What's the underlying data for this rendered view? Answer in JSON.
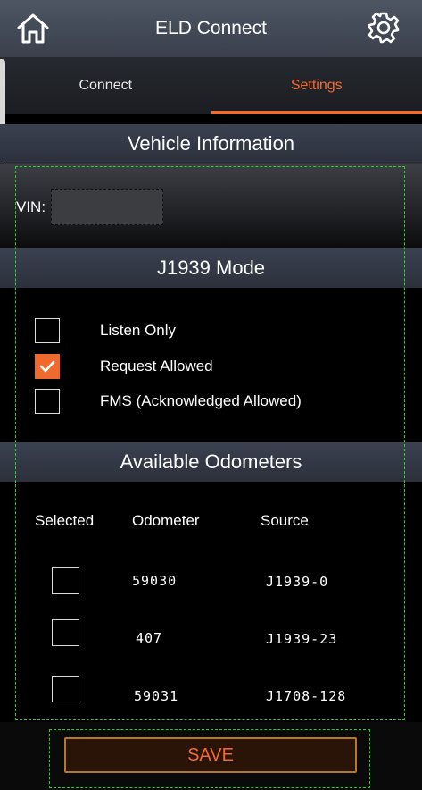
{
  "header": {
    "title": "ELD Connect",
    "home_icon": "home-icon",
    "settings_icon": "gear-icon"
  },
  "tabs": [
    {
      "label": "Connect",
      "active": false
    },
    {
      "label": "Settings",
      "active": true
    }
  ],
  "vehicle_info": {
    "title": "Vehicle Information",
    "vin_label": "VIN:",
    "vin_value": ""
  },
  "j1939": {
    "title": "J1939 Mode",
    "options": [
      {
        "label": "Listen Only",
        "checked": false
      },
      {
        "label": "Request Allowed",
        "checked": true
      },
      {
        "label": "FMS (Acknowledged Allowed)",
        "checked": false
      }
    ]
  },
  "odometers": {
    "title": "Available Odometers",
    "columns": [
      "Selected",
      "Odometer",
      "Source"
    ],
    "rows": [
      {
        "selected": false,
        "odometer": "59030",
        "source": "J1939-0"
      },
      {
        "selected": false,
        "odometer": "407",
        "source": "J1939-23"
      },
      {
        "selected": false,
        "odometer": "59031",
        "source": "J1708-128"
      }
    ]
  },
  "save_label": "SAVE",
  "colors": {
    "accent": "#f06a30",
    "highlight_outline": "#2bd12b"
  }
}
